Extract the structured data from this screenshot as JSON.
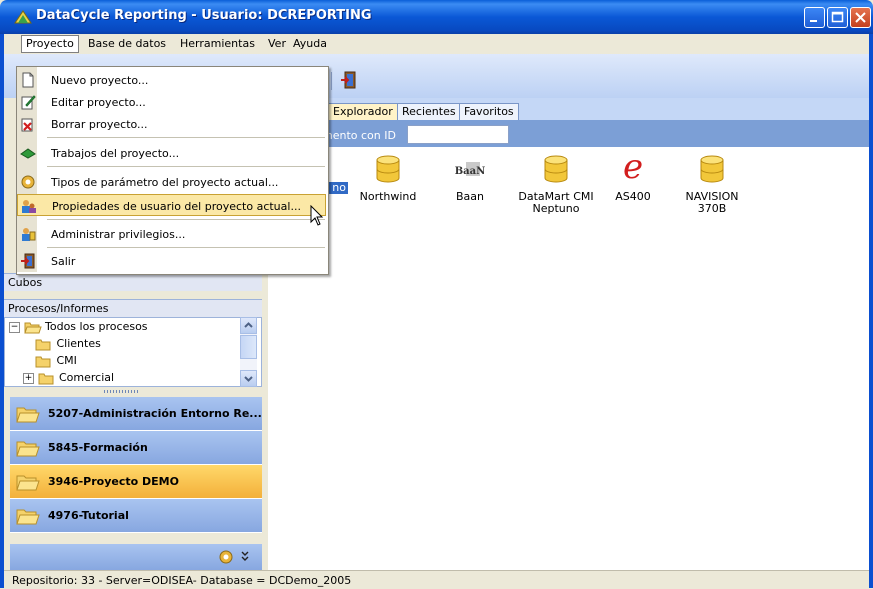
{
  "window": {
    "title": "DataCycle Reporting - Usuario: DCREPORTING",
    "buttons": [
      "minimize-icon",
      "maximize-icon",
      "close-icon"
    ]
  },
  "menubar": {
    "items": [
      "Proyecto",
      "Base de datos",
      "Herramientas",
      "Ver",
      "Ayuda"
    ],
    "active": "Proyecto"
  },
  "dropdown": {
    "items": [
      {
        "label": "Nuevo proyecto...",
        "icon": "new-document-icon"
      },
      {
        "label": "Editar proyecto...",
        "icon": "edit-icon"
      },
      {
        "label": "Borrar proyecto...",
        "icon": "delete-icon"
      },
      {
        "label": "Trabajos del proyecto...",
        "icon": "jobs-icon"
      },
      {
        "label": "Tipos de parámetro del proyecto actual...",
        "icon": "gears-icon"
      },
      {
        "label": "Propiedades de usuario del proyecto actual...",
        "icon": "users-icon",
        "highlighted": true
      },
      {
        "label": "Administrar privilegios...",
        "icon": "privileges-icon"
      },
      {
        "label": "Salir",
        "icon": "exit-icon"
      }
    ]
  },
  "tabs": [
    "Explorador",
    "Recientes",
    "Favoritos"
  ],
  "active_tab": "Explorador",
  "search": {
    "label": "mento con ID",
    "value": ""
  },
  "databases": [
    {
      "label": "no",
      "icon": "database-icon"
    },
    {
      "label": "Northwind",
      "icon": "database-icon"
    },
    {
      "label": "Baan",
      "icon": "baan-logo-icon",
      "logo_text": "BaaN"
    },
    {
      "label": "DataMart CMI\nNeptuno",
      "icon": "database-icon"
    },
    {
      "label": "AS400",
      "icon": "e-logo-icon",
      "logo_text": "e"
    },
    {
      "label": "NAVISION\n370B",
      "icon": "database-icon"
    }
  ],
  "left_pane": {
    "cubes_header": "Cubos",
    "processes_header": "Procesos/Informes",
    "tree": [
      {
        "label": "Todos los procesos",
        "expander": "−"
      },
      {
        "label": "Clientes"
      },
      {
        "label": "CMI"
      },
      {
        "label": "Comercial",
        "expander": "+"
      }
    ],
    "projects": [
      {
        "label": "5207-Administración Entorno Re..."
      },
      {
        "label": "5845-Formación"
      },
      {
        "label": "3946-Proyecto DEMO",
        "selected": true
      },
      {
        "label": "4976-Tutorial"
      }
    ],
    "footer_icons": [
      "gears-icon",
      "chevron-double-down-icon"
    ]
  },
  "statusbar": {
    "text": "Repositorio: 33 - Server=ODISEA- Database = DCDemo_2005"
  },
  "colors": {
    "titlebar": "#0a58d6",
    "project_selected": "#f3b03a",
    "project_normal": "#98b6e8",
    "menu_highlight": "#fbe8a6"
  }
}
